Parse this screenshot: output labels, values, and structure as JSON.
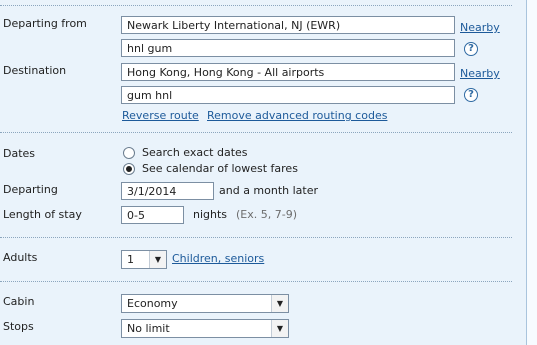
{
  "route": {
    "departing_label": "Departing from",
    "origin_value": "Newark Liberty International, NJ (EWR)",
    "origin_routing_value": "hnl gum",
    "destination_label": "Destination",
    "destination_value": "Hong Kong, Hong Kong - All airports",
    "destination_routing_value": "gum hnl",
    "nearby_label": "Nearby",
    "help_symbol": "?",
    "reverse_route_label": "Reverse route",
    "remove_codes_label": "Remove advanced routing codes"
  },
  "dates": {
    "label": "Dates",
    "option_exact": "Search exact dates",
    "option_calendar": "See calendar of lowest fares",
    "selected": "calendar",
    "departing_label": "Departing",
    "departing_value": "3/1/2014",
    "departing_suffix": "and a month later",
    "stay_label": "Length of stay",
    "stay_value": "0-5",
    "stay_unit": "nights",
    "stay_hint": "(Ex. 5, 7-9)"
  },
  "passengers": {
    "adults_label": "Adults",
    "adults_value": "1",
    "children_link": "Children, seniors"
  },
  "cabin": {
    "label": "Cabin",
    "value": "Economy"
  },
  "stops": {
    "label": "Stops",
    "value": "No limit"
  },
  "dropdown_arrow": "▼"
}
